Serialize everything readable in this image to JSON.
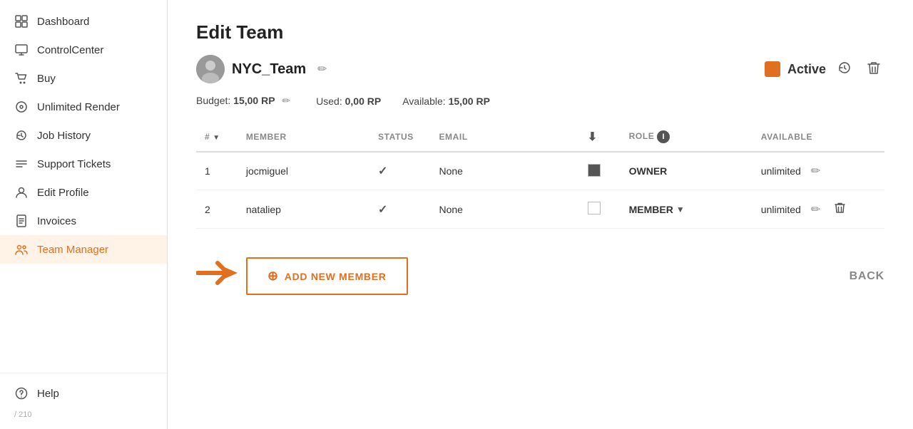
{
  "sidebar": {
    "items": [
      {
        "id": "dashboard",
        "label": "Dashboard",
        "icon": "grid"
      },
      {
        "id": "control-center",
        "label": "ControlCenter",
        "icon": "monitor"
      },
      {
        "id": "buy",
        "label": "Buy",
        "icon": "cart"
      },
      {
        "id": "unlimited-render",
        "label": "Unlimited Render",
        "icon": "disc"
      },
      {
        "id": "job-history",
        "label": "Job History",
        "icon": "history"
      },
      {
        "id": "support-tickets",
        "label": "Support Tickets",
        "icon": "list"
      },
      {
        "id": "edit-profile",
        "label": "Edit Profile",
        "icon": "person"
      },
      {
        "id": "invoices",
        "label": "Invoices",
        "icon": "document"
      },
      {
        "id": "team-manager",
        "label": "Team Manager",
        "icon": "team",
        "active": true
      }
    ],
    "bottom": [
      {
        "id": "help",
        "label": "Help",
        "icon": "help"
      }
    ],
    "footer_text": "/ 210"
  },
  "main": {
    "page_title": "Edit Team",
    "team": {
      "name": "NYC_Team",
      "status": "Active",
      "budget_label": "Budget:",
      "budget_value": "15,00 RP",
      "used_label": "Used:",
      "used_value": "0,00 RP",
      "available_label": "Available:",
      "available_value": "15,00 RP"
    },
    "table": {
      "headers": [
        {
          "id": "num",
          "label": "#",
          "sortable": true
        },
        {
          "id": "member",
          "label": "MEMBER",
          "sortable": false
        },
        {
          "id": "status",
          "label": "STATUS",
          "sortable": false
        },
        {
          "id": "email",
          "label": "EMAIL",
          "sortable": false
        },
        {
          "id": "download",
          "label": "↓",
          "sortable": false
        },
        {
          "id": "role",
          "label": "ROLE",
          "sortable": false,
          "info": true
        },
        {
          "id": "available",
          "label": "AVAILABLE",
          "sortable": false
        }
      ],
      "rows": [
        {
          "num": 1,
          "member": "jocmiguel",
          "status_check": true,
          "email": "None",
          "has_checkbox": true,
          "checkbox_filled": true,
          "role": "OWNER",
          "role_dropdown": false,
          "available": "unlimited",
          "can_delete": false
        },
        {
          "num": 2,
          "member": "nataliep",
          "status_check": true,
          "email": "None",
          "has_checkbox": true,
          "checkbox_filled": false,
          "role": "MEMBER",
          "role_dropdown": true,
          "available": "unlimited",
          "can_delete": true
        }
      ]
    },
    "add_member_label": "ADD NEW MEMBER",
    "back_label": "BACK"
  }
}
